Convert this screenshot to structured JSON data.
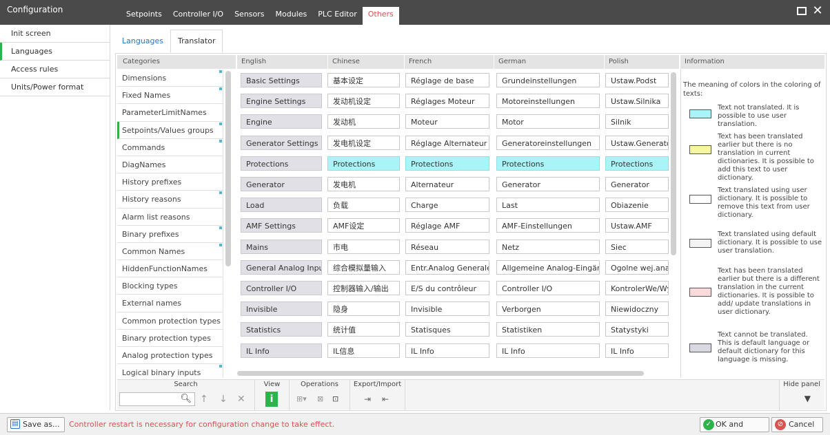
{
  "app": {
    "title": "Configuration",
    "tabs": [
      "Setpoints",
      "Controller I/O",
      "Sensors",
      "Modules",
      "PLC Editor",
      "Others"
    ],
    "active_tab": "Others"
  },
  "sidebar": {
    "items": [
      {
        "label": "Init screen"
      },
      {
        "label": "Languages"
      },
      {
        "label": "Access rules"
      },
      {
        "label": "Units/Power format"
      }
    ],
    "active": "Languages"
  },
  "subtabs": [
    {
      "label": "Languages"
    },
    {
      "label": "Translator"
    }
  ],
  "categories": {
    "header": "Categories",
    "items": [
      {
        "label": "Dimensions"
      },
      {
        "label": "Fixed Names"
      },
      {
        "label": "ParameterLimitNames"
      },
      {
        "label": "Setpoints/Values groups"
      },
      {
        "label": "Commands"
      },
      {
        "label": "DiagNames"
      },
      {
        "label": "History prefixes"
      },
      {
        "label": "History reasons"
      },
      {
        "label": "Alarm list reasons"
      },
      {
        "label": "Binary prefixes"
      },
      {
        "label": "Common Names"
      },
      {
        "label": "HiddenFunctionNames"
      },
      {
        "label": "Blocking types"
      },
      {
        "label": "External names"
      },
      {
        "label": "Common protection types"
      },
      {
        "label": "Binary protection types"
      },
      {
        "label": "Analog protection types"
      },
      {
        "label": "Logical binary inputs"
      }
    ],
    "active": "Setpoints/Values groups"
  },
  "grid": {
    "headers": [
      "English",
      "Chinese",
      "French",
      "German",
      "Polish"
    ],
    "rows": [
      {
        "en": "Basic Settings",
        "zh": "基本设定",
        "fr": "Réglage de base",
        "de": "Grundeinstellungen",
        "pl": "Ustaw.Podst",
        "untranslated": false
      },
      {
        "en": "Engine Settings",
        "zh": "发动机设定",
        "fr": "Réglages Moteur",
        "de": "Motoreinstellungen",
        "pl": "Ustaw.Silnika",
        "untranslated": false
      },
      {
        "en": "Engine",
        "zh": "发动机",
        "fr": "Moteur",
        "de": "Motor",
        "pl": "Silnik",
        "untranslated": false
      },
      {
        "en": "Generator Settings",
        "zh": "发电机设定",
        "fr": "Réglage Alternateur",
        "de": "Generatoreinstellungen",
        "pl": "Ustaw.Generatora",
        "untranslated": false
      },
      {
        "en": "Protections",
        "zh": "Protections",
        "fr": "Protections",
        "de": "Protections",
        "pl": "Protections",
        "untranslated": true
      },
      {
        "en": "Generator",
        "zh": "发电机",
        "fr": "Alternateur",
        "de": "Generator",
        "pl": "Generator",
        "untranslated": false
      },
      {
        "en": "Load",
        "zh": "负载",
        "fr": "Charge",
        "de": "Last",
        "pl": "Obiazenie",
        "untranslated": false
      },
      {
        "en": "AMF Settings",
        "zh": "AMF设定",
        "fr": "Réglage AMF",
        "de": "AMF-Einstellungen",
        "pl": "Ustaw.AMF",
        "untranslated": false
      },
      {
        "en": "Mains",
        "zh": "市电",
        "fr": "Réseau",
        "de": "Netz",
        "pl": "Siec",
        "untranslated": false
      },
      {
        "en": "General Analog Inputs",
        "zh": "综合模拟量输入",
        "fr": "Entr.Analog Generales",
        "de": "Allgemeine Analog-Eingänge",
        "pl": "Ogolne wej.analog",
        "untranslated": false
      },
      {
        "en": "Controller I/O",
        "zh": "控制器输入/输出",
        "fr": "E/S du contrôleur",
        "de": "Controller I/O",
        "pl": "KontrolerWe/Wy",
        "untranslated": false
      },
      {
        "en": "Invisible",
        "zh": "隐身",
        "fr": "Invisible",
        "de": "Verborgen",
        "pl": "Niewidoczny",
        "untranslated": false
      },
      {
        "en": "Statistics",
        "zh": "统计值",
        "fr": "Statisques",
        "de": "Statistiken",
        "pl": "Statystyki",
        "untranslated": false
      },
      {
        "en": "IL Info",
        "zh": "IL信息",
        "fr": "IL Info",
        "de": "IL Info",
        "pl": "IL Info",
        "untranslated": false
      }
    ]
  },
  "info": {
    "header": "Information",
    "intro": "The meaning of colors in the coloring of texts:",
    "legend": [
      {
        "color": "#a8f4f6",
        "text": "Text not translated. It is possible to use user translation."
      },
      {
        "color": "#f6f6a0",
        "text": "Text has been translated earlier but there is no translation in current dictionaries. It is possible to add this text to user dictionary."
      },
      {
        "color": "#ffffff",
        "text": "Text translated using user dictionary. It is possible to remove this text from user dictionary."
      },
      {
        "color": "#f4f4f4",
        "text": "Text translated using default dictionary. It is possible to use user translation."
      },
      {
        "color": "#fadada",
        "text": "Text has been translated earlier but there is a different translation in the current dictionaries. It is possible to add/ update translations in user dictionary."
      },
      {
        "color": "#d8d8e0",
        "text": "Text cannot be translated. This is default language or default dictionary for this language is missing."
      }
    ]
  },
  "toolbar": {
    "search_label": "Search",
    "search_value": "",
    "view_label": "View",
    "operations_label": "Operations",
    "export_label": "Export/Import",
    "hide_label": "Hide panel",
    "accent": "#2db34a"
  },
  "statusbar": {
    "save_label": "Save as...",
    "message": "Controller restart is necessary for configuration change to take effect.",
    "ok_label": "OK and Restart",
    "cancel_label": "Cancel"
  }
}
